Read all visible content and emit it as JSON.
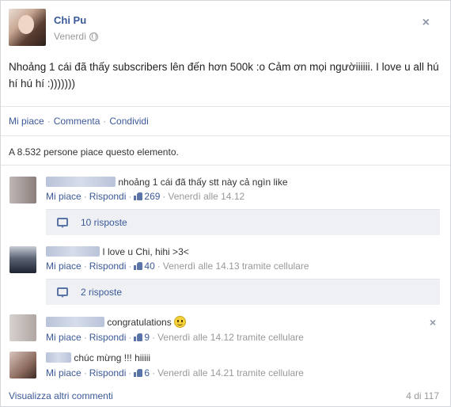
{
  "post": {
    "author": "Chi Pu",
    "time": "Venerdì",
    "text": "Nhoảng 1 cái đã thấy subscribers lên đến hơn 500k :o Cảm ơn mọi ngườiiiiii. I love u all hú hí hú hí :)))))))"
  },
  "actions": {
    "like": "Mi piace",
    "comment": "Commenta",
    "share": "Condividi",
    "separator": "·"
  },
  "likes_summary": "A 8.532 persone piace questo elemento.",
  "comments": [
    {
      "text": "nhoảng 1 cái đã thấy stt này cả ngìn like",
      "like_label": "Mi piace",
      "reply_label": "Rispondi",
      "likes": "269",
      "time": "Venerdì alle 14.12",
      "replies": "10 risposte"
    },
    {
      "text": "I love u Chi, hihi >3<",
      "like_label": "Mi piace",
      "reply_label": "Rispondi",
      "likes": "40",
      "time": "Venerdì alle 14.13 tramite cellulare",
      "replies": "2 risposte"
    },
    {
      "text": "congratulations",
      "like_label": "Mi piace",
      "reply_label": "Rispondi",
      "likes": "9",
      "time": "Venerdì alle 14.12 tramite cellulare"
    },
    {
      "text": "chúc mừng !!! hiiiii",
      "like_label": "Mi piace",
      "reply_label": "Rispondi",
      "likes": "6",
      "time": "Venerdì alle 14.21 tramite cellulare"
    }
  ],
  "footer": {
    "more_comments": "Visualizza altri commenti",
    "count": "4 di 117"
  },
  "icons": {
    "close": "×"
  },
  "colors": {
    "link": "#3b5998",
    "meta": "#999999",
    "replies_bg": "#eef0f4"
  }
}
